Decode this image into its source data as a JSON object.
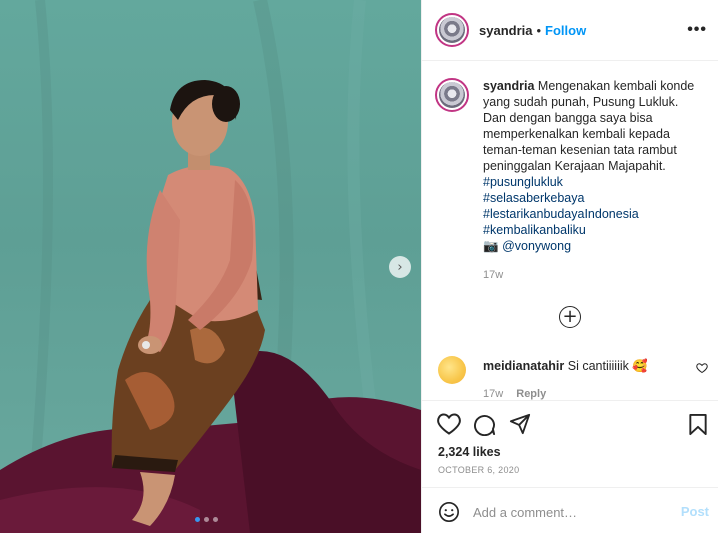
{
  "post": {
    "username": "syandria",
    "separator": "•",
    "follow_label": "Follow",
    "more_label": "•••"
  },
  "caption": {
    "username": "syandria",
    "text": "Mengenakan kembali konde yang sudah punah, Pusung Lukluk. Dan dengan bangga saya bisa memperkenalkan kembali kepada teman-teman kesenian tata rambut peninggalan Kerajaan Majapahit.",
    "hashtags": [
      "#pusunglukluk",
      "#selasaberkebaya",
      "#lestarikanbudayaIndonesia",
      "#kembalikanbaliku"
    ],
    "camera_emoji": "📷",
    "mention": "@vonywong",
    "time": "17w"
  },
  "comment": {
    "username": "meidianatahir",
    "text": "Si cantiiiiiik 🥰",
    "time": "17w",
    "reply_label": "Reply"
  },
  "load_more_label": "+",
  "likes": "2,324 likes",
  "date": "OCTOBER 6, 2020",
  "add_comment": {
    "placeholder": "Add a comment…",
    "post_label": "Post"
  },
  "carousel": {
    "next_label": "›",
    "slides": 3,
    "active_slide": 1
  },
  "colors": {
    "accent": "#0095f6",
    "post_disabled": "#b2dffc",
    "backdrop": "#63a89d",
    "fabric": "#5a1430"
  },
  "icons": [
    "more-options-icon",
    "heart-icon",
    "comment-icon",
    "share-icon",
    "save-icon",
    "emoji-icon",
    "plus-circle-icon",
    "chevron-right-icon"
  ]
}
